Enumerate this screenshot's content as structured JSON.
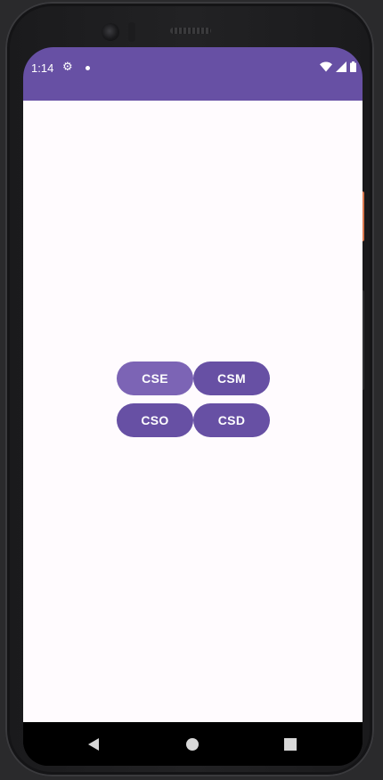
{
  "status_bar": {
    "time": "1:14",
    "icons": [
      "settings-gear-icon",
      "notification-dot-icon",
      "wifi-icon",
      "cellular-signal-icon",
      "battery-icon"
    ]
  },
  "buttons": [
    {
      "id": "cse",
      "label": "CSE",
      "state": "pressed"
    },
    {
      "id": "csm",
      "label": "CSM",
      "state": "default"
    },
    {
      "id": "cso",
      "label": "CSO",
      "state": "default"
    },
    {
      "id": "csd",
      "label": "CSD",
      "state": "default"
    }
  ],
  "navigation_bar": {
    "icons": [
      "back-icon",
      "home-icon",
      "recents-icon"
    ]
  },
  "colors": {
    "primary": "#6750a4",
    "primary_pressed": "#7c64b5",
    "background": "#fffbfe",
    "on_primary": "#ffffff"
  }
}
